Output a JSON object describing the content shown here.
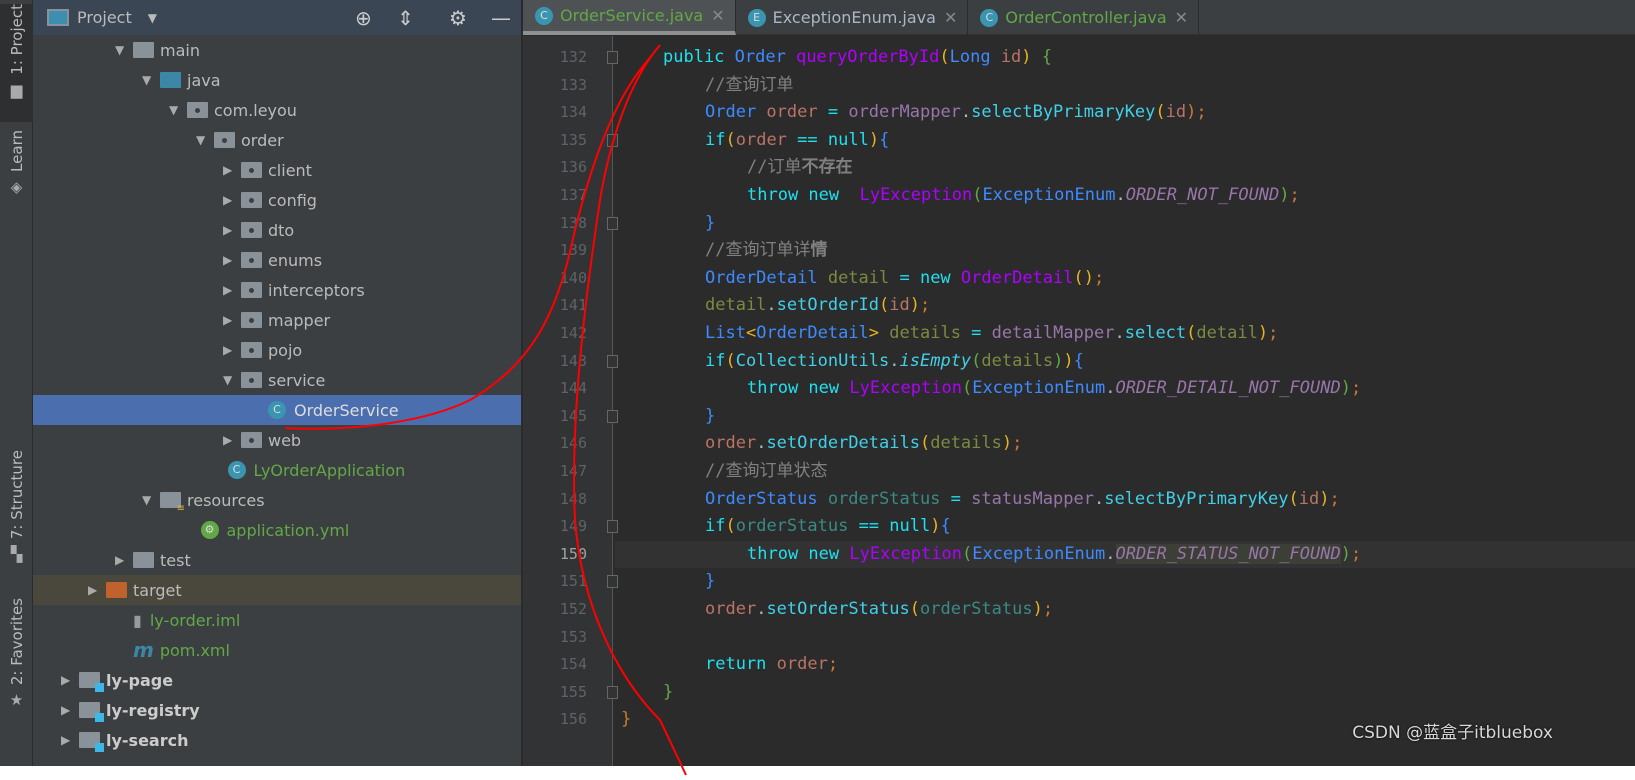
{
  "stripe": {
    "project": "1: Project",
    "learn": "Learn",
    "structure": "7: Structure",
    "favorites": "2: Favorites"
  },
  "panel": {
    "title": "Project",
    "tree": [
      {
        "label": "main",
        "indent": 0,
        "arrow": "down",
        "icon": "folder"
      },
      {
        "label": "java",
        "indent": 1,
        "arrow": "down",
        "icon": "source-folder"
      },
      {
        "label": "com.leyou",
        "indent": 2,
        "arrow": "down",
        "icon": "package"
      },
      {
        "label": "order",
        "indent": 3,
        "arrow": "down",
        "icon": "package"
      },
      {
        "label": "client",
        "indent": 4,
        "arrow": "right",
        "icon": "package"
      },
      {
        "label": "config",
        "indent": 4,
        "arrow": "right",
        "icon": "package"
      },
      {
        "label": "dto",
        "indent": 4,
        "arrow": "right",
        "icon": "package"
      },
      {
        "label": "enums",
        "indent": 4,
        "arrow": "right",
        "icon": "package"
      },
      {
        "label": "interceptors",
        "indent": 4,
        "arrow": "right",
        "icon": "package"
      },
      {
        "label": "mapper",
        "indent": 4,
        "arrow": "right",
        "icon": "package"
      },
      {
        "label": "pojo",
        "indent": 4,
        "arrow": "right",
        "icon": "package"
      },
      {
        "label": "service",
        "indent": 4,
        "arrow": "down",
        "icon": "package"
      },
      {
        "label": "OrderService",
        "indent": 5,
        "arrow": "",
        "icon": "class",
        "selected": true
      },
      {
        "label": "web",
        "indent": 4,
        "arrow": "right",
        "icon": "package"
      },
      {
        "label": "LyOrderApplication",
        "indent": 3.5,
        "arrow": "",
        "icon": "spring-boot-class",
        "green": true
      },
      {
        "label": "resources",
        "indent": 1,
        "arrow": "down",
        "icon": "resources-folder"
      },
      {
        "label": "application.yml",
        "indent": 2.5,
        "arrow": "",
        "icon": "spring-config",
        "green": true
      },
      {
        "label": "test",
        "indent": 0,
        "arrow": "right",
        "icon": "folder"
      },
      {
        "label": "target",
        "indent": -1,
        "arrow": "right",
        "icon": "excluded-folder",
        "highlight": true
      },
      {
        "label": "ly-order.iml",
        "indent": 0,
        "arrow": "",
        "icon": "iml-file",
        "green": true
      },
      {
        "label": "pom.xml",
        "indent": 0,
        "arrow": "",
        "icon": "maven",
        "green": true
      },
      {
        "label": "ly-page",
        "indent": -2,
        "arrow": "right",
        "icon": "module",
        "bold": true
      },
      {
        "label": "ly-registry",
        "indent": -2,
        "arrow": "right",
        "icon": "module",
        "bold": true
      },
      {
        "label": "ly-search",
        "indent": -2,
        "arrow": "right",
        "icon": "module",
        "bold": true
      }
    ]
  },
  "tabs": [
    {
      "label": "OrderService.java",
      "icon": "C",
      "active": true
    },
    {
      "label": "ExceptionEnum.java",
      "icon": "E"
    },
    {
      "label": "OrderController.java",
      "icon": "C"
    }
  ],
  "editor": {
    "current_line": 150,
    "lines": [
      {
        "n": 132,
        "i": 1,
        "t": [
          [
            "public ",
            "kw"
          ],
          [
            "Order ",
            "ty"
          ],
          [
            "queryOrderById",
            "fn"
          ],
          [
            "(",
            "pr"
          ],
          [
            "Long ",
            "ty"
          ],
          [
            "id",
            "lv"
          ],
          [
            ") ",
            "pr"
          ],
          [
            "{",
            "pp"
          ]
        ]
      },
      {
        "n": 133,
        "i": 2,
        "t": [
          [
            "//查询订单",
            "cm"
          ]
        ]
      },
      {
        "n": 134,
        "i": 2,
        "t": [
          [
            "Order ",
            "ty"
          ],
          [
            "order ",
            "lv"
          ],
          [
            "= ",
            "op"
          ],
          [
            "orderMapper",
            "mf"
          ],
          [
            ".",
            "pl"
          ],
          [
            "selectByPrimaryKey",
            "mc"
          ],
          [
            "(",
            "pr"
          ],
          [
            "id",
            "lv"
          ],
          [
            ");",
            "sc"
          ]
        ]
      },
      {
        "n": 135,
        "i": 2,
        "t": [
          [
            "if",
            "kw"
          ],
          [
            "(",
            "pr"
          ],
          [
            "order ",
            "lv"
          ],
          [
            "== null",
            "kw"
          ],
          [
            ")",
            "pr"
          ],
          [
            "{",
            "br"
          ]
        ]
      },
      {
        "n": 136,
        "i": 3,
        "t": [
          [
            "//订单",
            "cm"
          ],
          [
            "不存在",
            "cmb"
          ]
        ]
      },
      {
        "n": 137,
        "i": 3,
        "t": [
          [
            "throw new  ",
            "kw"
          ],
          [
            "LyException",
            "fn"
          ],
          [
            "(",
            "pp"
          ],
          [
            "ExceptionEnum",
            "ty"
          ],
          [
            ".",
            "pl"
          ],
          [
            "ORDER_NOT_FOUND",
            "en"
          ],
          [
            ")",
            "pp"
          ],
          [
            ";",
            "sc"
          ]
        ]
      },
      {
        "n": 138,
        "i": 2,
        "t": [
          [
            "}",
            "br"
          ]
        ]
      },
      {
        "n": 139,
        "i": 2,
        "t": [
          [
            "//查询订单详",
            "cm"
          ],
          [
            "情",
            "cmb"
          ]
        ]
      },
      {
        "n": 140,
        "i": 2,
        "t": [
          [
            "OrderDetail ",
            "ty"
          ],
          [
            "detail ",
            "dv"
          ],
          [
            "= new ",
            "kw"
          ],
          [
            "OrderDetail",
            "fn"
          ],
          [
            "()",
            "pr"
          ],
          [
            ";",
            "sc"
          ]
        ]
      },
      {
        "n": 141,
        "i": 2,
        "t": [
          [
            "detail",
            "dv"
          ],
          [
            ".",
            "pl"
          ],
          [
            "setOrderId",
            "mc"
          ],
          [
            "(",
            "pr"
          ],
          [
            "id",
            "lv"
          ],
          [
            ")",
            "pr"
          ],
          [
            ";",
            "sc"
          ]
        ]
      },
      {
        "n": 142,
        "i": 2,
        "t": [
          [
            "List",
            "ty"
          ],
          [
            "<",
            "pr"
          ],
          [
            "OrderDetail",
            "ty"
          ],
          [
            "> ",
            "pr"
          ],
          [
            "details ",
            "dv"
          ],
          [
            "= ",
            "op"
          ],
          [
            "detailMapper",
            "mf"
          ],
          [
            ".",
            "pl"
          ],
          [
            "select",
            "mc"
          ],
          [
            "(",
            "pr"
          ],
          [
            "detail",
            "dv"
          ],
          [
            ")",
            "pr"
          ],
          [
            ";",
            "sc"
          ]
        ]
      },
      {
        "n": 143,
        "i": 2,
        "t": [
          [
            "if",
            "kw"
          ],
          [
            "(",
            "pr"
          ],
          [
            "CollectionUtils",
            "mc"
          ],
          [
            ".",
            "pl"
          ],
          [
            "isEmpty",
            "st"
          ],
          [
            "(",
            "pp"
          ],
          [
            "details",
            "dv"
          ],
          [
            ")",
            "pp"
          ],
          [
            ")",
            "pr"
          ],
          [
            "{",
            "br"
          ]
        ]
      },
      {
        "n": 144,
        "i": 3,
        "t": [
          [
            "throw new ",
            "kw"
          ],
          [
            "LyException",
            "fn"
          ],
          [
            "(",
            "pp"
          ],
          [
            "ExceptionEnum",
            "ty"
          ],
          [
            ".",
            "pl"
          ],
          [
            "ORDER_DETAIL_NOT_FOUND",
            "en"
          ],
          [
            ")",
            "pp"
          ],
          [
            ";",
            "sc"
          ]
        ]
      },
      {
        "n": 145,
        "i": 2,
        "t": [
          [
            "}",
            "br"
          ]
        ]
      },
      {
        "n": 146,
        "i": 2,
        "t": [
          [
            "order",
            "lv"
          ],
          [
            ".",
            "pl"
          ],
          [
            "setOrderDetails",
            "mc"
          ],
          [
            "(",
            "pr"
          ],
          [
            "details",
            "dv"
          ],
          [
            ")",
            "pr"
          ],
          [
            ";",
            "sc"
          ]
        ]
      },
      {
        "n": 147,
        "i": 2,
        "t": [
          [
            "//查询订单状态",
            "cm"
          ]
        ]
      },
      {
        "n": 148,
        "i": 2,
        "t": [
          [
            "OrderStatus ",
            "ty"
          ],
          [
            "orderStatus ",
            "os"
          ],
          [
            "= ",
            "op"
          ],
          [
            "statusMapper",
            "mf"
          ],
          [
            ".",
            "pl"
          ],
          [
            "selectByPrimaryKey",
            "mc"
          ],
          [
            "(",
            "pr"
          ],
          [
            "id",
            "lv"
          ],
          [
            ")",
            "pr"
          ],
          [
            ";",
            "sc"
          ]
        ]
      },
      {
        "n": 149,
        "i": 2,
        "t": [
          [
            "if",
            "kw"
          ],
          [
            "(",
            "pr"
          ],
          [
            "orderStatus ",
            "os"
          ],
          [
            "== null",
            "kw"
          ],
          [
            ")",
            "pr"
          ],
          [
            "{",
            "br"
          ]
        ]
      },
      {
        "n": 150,
        "i": 3,
        "t": [
          [
            "throw new ",
            "kw"
          ],
          [
            "LyException",
            "fn"
          ],
          [
            "(",
            "pp"
          ],
          [
            "ExceptionEnum",
            "ty"
          ],
          [
            ".",
            "pl"
          ],
          [
            "ORDER_STATUS_NOT_FOUND",
            "en enhl"
          ],
          [
            ")",
            "pp"
          ],
          [
            ";",
            "sc"
          ]
        ]
      },
      {
        "n": 151,
        "i": 2,
        "t": [
          [
            "}",
            "br"
          ]
        ]
      },
      {
        "n": 152,
        "i": 2,
        "t": [
          [
            "order",
            "lv"
          ],
          [
            ".",
            "pl"
          ],
          [
            "setOrderStatus",
            "mc"
          ],
          [
            "(",
            "pr"
          ],
          [
            "orderStatus",
            "os"
          ],
          [
            ")",
            "pr"
          ],
          [
            ";",
            "sc"
          ]
        ]
      },
      {
        "n": 153,
        "i": 2,
        "t": []
      },
      {
        "n": 154,
        "i": 2,
        "t": [
          [
            "return ",
            "kw"
          ],
          [
            "order",
            "lv"
          ],
          [
            ";",
            "sc"
          ]
        ]
      },
      {
        "n": 155,
        "i": 1,
        "t": [
          [
            "}",
            "pp"
          ]
        ]
      },
      {
        "n": 156,
        "i": 0,
        "t": [
          [
            "}",
            "sc"
          ]
        ]
      }
    ]
  },
  "watermark": "CSDN @蓝盒子itbluebox",
  "annotation_color": "#ff0000"
}
